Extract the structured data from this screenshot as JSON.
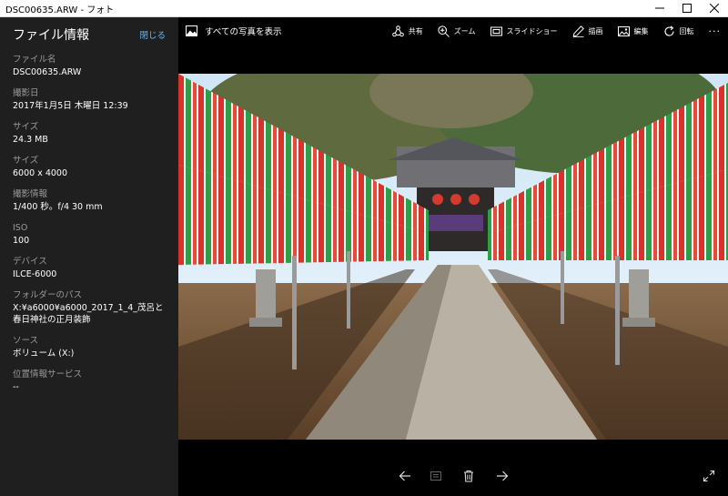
{
  "window": {
    "title": "DSC00635.ARW - フォト"
  },
  "panel": {
    "title": "ファイル情報",
    "close_label": "閉じる",
    "fields": [
      {
        "label": "ファイル名",
        "value": "DSC00635.ARW"
      },
      {
        "label": "撮影日",
        "value": "2017年1月5日 木曜日 12:39"
      },
      {
        "label": "サイズ",
        "value": "24.3 MB"
      },
      {
        "label": "サイズ",
        "value": "6000 x 4000"
      },
      {
        "label": "撮影情報",
        "value": "1/400 秒。f/4 30 mm"
      },
      {
        "label": "ISO",
        "value": "100"
      },
      {
        "label": "デバイス",
        "value": "ILCE-6000"
      },
      {
        "label": "フォルダーのパス",
        "value": "X:¥a6000¥a6000_2017_1_4_茂呂と春日神社の正月装飾"
      },
      {
        "label": "ソース",
        "value": "ボリューム (X:)"
      },
      {
        "label": "位置情報サービス",
        "value": "--"
      }
    ]
  },
  "toolbar": {
    "all_photos": "すべての写真を表示",
    "share": "共有",
    "zoom": "ズーム",
    "slideshow": "スライドショー",
    "draw": "描画",
    "edit": "編集",
    "rotate": "回転",
    "more": "···"
  },
  "colors": {
    "panel_bg": "#1f1f1f",
    "accent": "#64b5f6",
    "label": "#9a9a9a"
  }
}
